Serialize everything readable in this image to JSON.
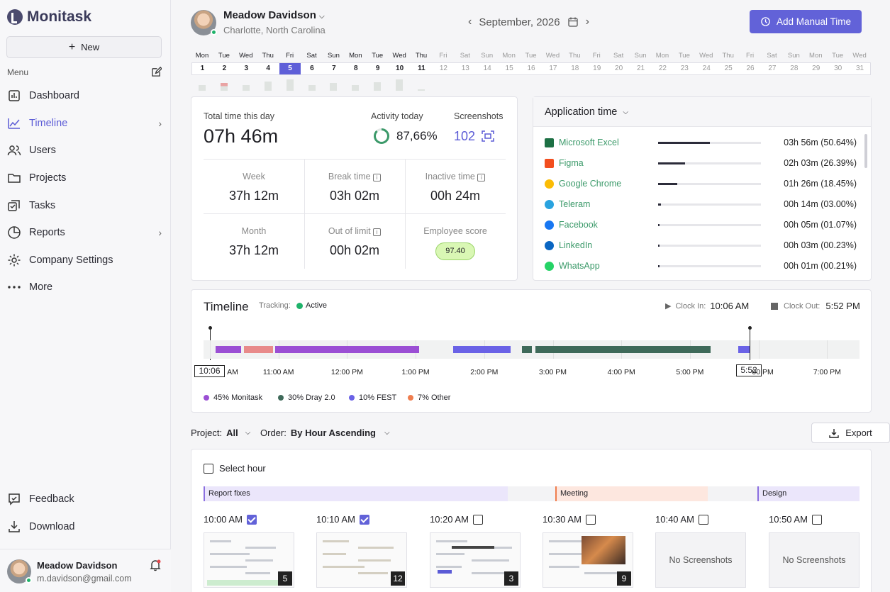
{
  "app": {
    "name": "Monitask",
    "new_label": "New",
    "menu_label": "Menu"
  },
  "nav": [
    {
      "label": "Dashboard",
      "icon": "bar-chart-icon"
    },
    {
      "label": "Timeline",
      "icon": "line-chart-icon",
      "active": true,
      "chevron": true
    },
    {
      "label": "Users",
      "icon": "users-icon"
    },
    {
      "label": "Projects",
      "icon": "folder-icon"
    },
    {
      "label": "Tasks",
      "icon": "tasks-icon"
    },
    {
      "label": "Reports",
      "icon": "pie-chart-icon",
      "chevron": true
    },
    {
      "label": "Company Settings",
      "icon": "gear-icon"
    },
    {
      "label": "More",
      "icon": "more-dots-icon"
    }
  ],
  "bottom_nav": [
    {
      "label": "Feedback",
      "icon": "feedback-icon"
    },
    {
      "label": "Download",
      "icon": "download-icon"
    }
  ],
  "account": {
    "name": "Meadow Davidson",
    "email": "m.davidson@gmail.com"
  },
  "header": {
    "user_name": "Meadow Davidson",
    "location": "Charlotte, North Carolina",
    "month": "September, 2026",
    "add_button": "Add Manual Time"
  },
  "calendar": {
    "weekdays": [
      "Mon",
      "Tue",
      "Wed",
      "Thu",
      "Fri",
      "Sat",
      "Sun",
      "Mon",
      "Tue",
      "Wed",
      "Thu",
      "Fri",
      "Sat",
      "Sun",
      "Mon",
      "Tue",
      "Wed",
      "Thu",
      "Fri",
      "Sat",
      "Sun",
      "Mon",
      "Tue",
      "Wed",
      "Thu",
      "Fri",
      "Sat",
      "Sun",
      "Mon",
      "Tue",
      "Wed"
    ],
    "days": [
      "1",
      "2",
      "3",
      "4",
      "5",
      "6",
      "7",
      "8",
      "9",
      "10",
      "11",
      "12",
      "13",
      "14",
      "15",
      "16",
      "17",
      "18",
      "19",
      "20",
      "21",
      "22",
      "23",
      "24",
      "25",
      "26",
      "27",
      "28",
      "29",
      "30",
      "31"
    ],
    "selected": "5",
    "activity": [
      0.4,
      0.55,
      0.4,
      0.65,
      0.8,
      0.4,
      0.55,
      0.4,
      0.6,
      0.8,
      0.1
    ]
  },
  "stats": {
    "total_label": "Total time this day",
    "total_value": "07h 46m",
    "activity_label": "Activity today",
    "activity_value": "87,66%",
    "activity_fraction": 0.8766,
    "screenshots_label": "Screenshots",
    "screenshots_value": "102",
    "week_label": "Week",
    "week_value": "37h 12m",
    "break_label": "Break time",
    "break_value": "03h 02m",
    "inactive_label": "Inactive time",
    "inactive_value": "00h 24m",
    "month_label": "Month",
    "month_value": "37h 12m",
    "outlimit_label": "Out of limit",
    "outlimit_value": "00h 02m",
    "score_label": "Employee score",
    "score_value": "97.40"
  },
  "apps": {
    "title": "Application time",
    "items": [
      {
        "name": "Microsoft Excel",
        "time": "03h 56m (50.64%)",
        "fraction": 0.5064,
        "color": "#1d7044"
      },
      {
        "name": "Figma",
        "time": "02h 03m (26.39%)",
        "fraction": 0.2639,
        "color": "#f24e1e"
      },
      {
        "name": "Google Chrome",
        "time": "01h 26m (18.45%)",
        "fraction": 0.1845,
        "color": "#fbbc05"
      },
      {
        "name": "Teleram",
        "time": "00h 14m (03.00%)",
        "fraction": 0.03,
        "color": "#2aa3df"
      },
      {
        "name": "Facebook",
        "time": "00h 05m (01.07%)",
        "fraction": 0.0107,
        "color": "#1877f2"
      },
      {
        "name": "LinkedIn",
        "time": "00h 03m (00.23%)",
        "fraction": 0.0023,
        "color": "#0a66c2"
      },
      {
        "name": "WhatsApp",
        "time": "00h 01m (00.21%)",
        "fraction": 0.0021,
        "color": "#25d366"
      }
    ]
  },
  "timeline": {
    "title": "Timeline",
    "tracking_label": "Tracking:",
    "tracking_value": "Active",
    "clock_in_label": "Clock In:",
    "clock_in_value": "10:06 AM",
    "clock_out_label": "Clock Out:",
    "clock_out_value": "5:52 PM",
    "start_marker": "10:06",
    "end_marker": "5:52",
    "hours": [
      "AM",
      "11:00 AM",
      "12:00 PM",
      "1:00 PM",
      "2:00 PM",
      "3:00 PM",
      "4:00 PM",
      "5:00 PM",
      "00 PM",
      "7:00 PM"
    ],
    "segments": [
      {
        "start": 10.08,
        "end": 10.45,
        "color": "#9b4fd4"
      },
      {
        "start": 10.5,
        "end": 10.92,
        "color": "#e88a8a"
      },
      {
        "start": 10.95,
        "end": 13.05,
        "color": "#9b4fd4"
      },
      {
        "start": 13.55,
        "end": 14.38,
        "color": "#6a62e6"
      },
      {
        "start": 14.55,
        "end": 14.7,
        "color": "#3f6a5a"
      },
      {
        "start": 14.75,
        "end": 17.3,
        "color": "#3f6a5a"
      },
      {
        "start": 17.7,
        "end": 17.87,
        "color": "#6a62e6"
      }
    ],
    "legend": [
      {
        "label": "45% Monitask",
        "color": "#9b4fd4"
      },
      {
        "label": "30% Dray 2.0",
        "color": "#3f6a5a"
      },
      {
        "label": "10% FEST",
        "color": "#6a62e6"
      },
      {
        "label": "7% Other",
        "color": "#ef7d4e"
      }
    ]
  },
  "filters": {
    "project_label": "Project:",
    "project_value": "All",
    "order_label": "Order:",
    "order_value": "By Hour Ascending",
    "export": "Export"
  },
  "shots": {
    "select_hour": "Select hour",
    "projects": [
      {
        "label": "Report fixes",
        "color": "#ebe6fb",
        "border": "#8b6fe0"
      },
      {
        "label": "Meeting",
        "color": "#fde7df",
        "border": "#ef7d4e"
      },
      {
        "label": "Design",
        "color": "#ebe6fb",
        "border": "#8b6fe0"
      }
    ],
    "slots": [
      {
        "time": "10:00 AM",
        "checked": true,
        "count": "5"
      },
      {
        "time": "10:10 AM",
        "checked": true,
        "count": "12"
      },
      {
        "time": "10:20 AM",
        "checked": false,
        "count": "3"
      },
      {
        "time": "10:30 AM",
        "checked": false,
        "count": "9"
      },
      {
        "time": "10:40 AM",
        "checked": false,
        "empty": "No Screenshots"
      },
      {
        "time": "10:50 AM",
        "checked": false,
        "empty": "No Screenshots"
      }
    ]
  }
}
